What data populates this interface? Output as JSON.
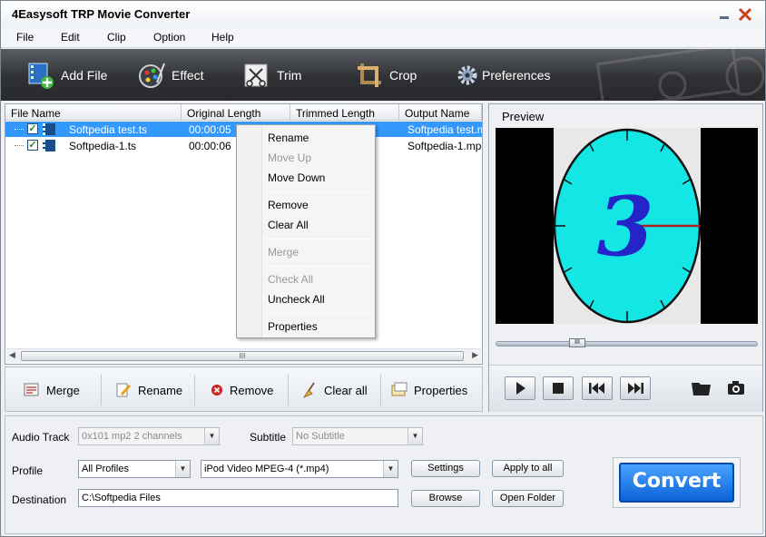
{
  "window": {
    "title": "4Easysoft TRP Movie Converter"
  },
  "menu": [
    "File",
    "Edit",
    "Clip",
    "Option",
    "Help"
  ],
  "toolbar": {
    "add_file": "Add File",
    "effect": "Effect",
    "trim": "Trim",
    "crop": "Crop",
    "preferences": "Preferences"
  },
  "filelist": {
    "columns": [
      "File Name",
      "Original Length",
      "Trimmed Length",
      "Output Name"
    ],
    "rows": [
      {
        "name": "Softpedia test.ts",
        "original": "00:00:05",
        "output": "Softpedia test.mp",
        "checked": true,
        "selected": true
      },
      {
        "name": "Softpedia-1.ts",
        "original": "00:00:06",
        "output": "Softpedia-1.mp",
        "checked": true,
        "selected": false
      }
    ],
    "scroll_thumb": "III"
  },
  "list_buttons": {
    "merge": "Merge",
    "rename": "Rename",
    "remove": "Remove",
    "clear_all": "Clear all",
    "properties": "Properties"
  },
  "context_menu": {
    "rename": "Rename",
    "move_up": "Move Up",
    "move_down": "Move Down",
    "remove": "Remove",
    "clear_all": "Clear All",
    "merge": "Merge",
    "check_all": "Check All",
    "uncheck_all": "Uncheck All",
    "properties": "Properties"
  },
  "preview": {
    "label": "Preview",
    "countdown_digit": "3"
  },
  "settings": {
    "audio_track_label": "Audio Track",
    "audio_track_value": "0x101 mp2 2 channels",
    "subtitle_label": "Subtitle",
    "subtitle_value": "No Subtitle",
    "profile_label": "Profile",
    "profile_category": "All Profiles",
    "profile_value": "iPod Video MPEG-4 (*.mp4)",
    "settings_button": "Settings",
    "apply_to_all_button": "Apply to all",
    "destination_label": "Destination",
    "destination_value": "C:\\Softpedia Files",
    "browse_button": "Browse",
    "open_folder_button": "Open Folder",
    "convert_button": "Convert"
  },
  "colors": {
    "toolbar_bg": "#2f3135",
    "selection": "#3399ff",
    "convert": "#0b63d8",
    "preview_dial": "#14e6e6"
  }
}
